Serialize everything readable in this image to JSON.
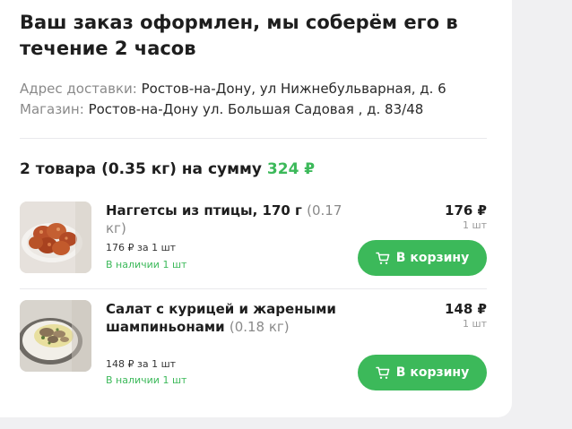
{
  "order": {
    "title": "Ваш заказ оформлен, мы соберём его в течение 2 часов",
    "address_label": "Адрес доставки:",
    "address_value": "Ростов-на-Дону, ул Нижнебульварная, д. 6",
    "store_label": "Магазин:",
    "store_value": "Ростов-на-Дону ул. Большая Садовая , д. 83/48"
  },
  "summary": {
    "text": "2 товара (0.35 кг) на сумму",
    "total": "324 ₽"
  },
  "items": [
    {
      "name": "Наггетсы из птицы, 170 г",
      "weight": "(0.17 кг)",
      "price": "176 ₽",
      "qty": "1 шт",
      "unit_price": "176 ₽ за 1 шт",
      "availability": "В наличии 1 шт",
      "button_label": "В корзину",
      "image_icon": "nuggets-image"
    },
    {
      "name": "Салат с курицей и жареными шампиньонами",
      "weight": "(0.18 кг)",
      "price": "148 ₽",
      "qty": "1 шт",
      "unit_price": "148 ₽ за 1 шт",
      "availability": "В наличии 1 шт",
      "button_label": "В корзину",
      "image_icon": "salad-image"
    }
  ],
  "colors": {
    "accent": "#3cb95a",
    "muted": "#8a8a8a",
    "background": "#f0f0f2"
  }
}
